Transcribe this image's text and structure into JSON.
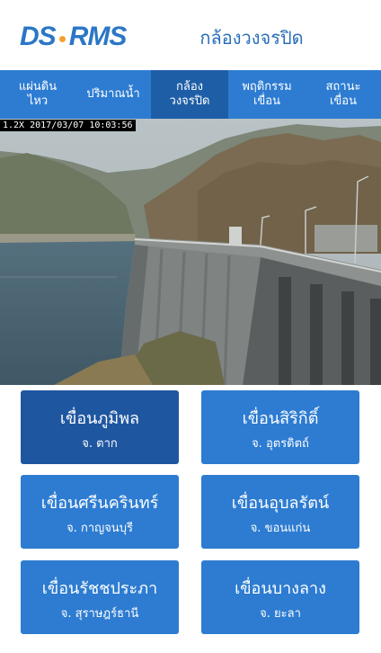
{
  "header": {
    "logo_left": "DS",
    "logo_right": "RMS",
    "title": "กล้องวงจรปิด"
  },
  "tabs": [
    {
      "label": "แผ่นดิน\nไหว"
    },
    {
      "label": "ปริมาณน้ำ"
    },
    {
      "label": "กล้อง\nวงจรปิด"
    },
    {
      "label": "พฤติกรรม\nเขื่อน"
    },
    {
      "label": "สถานะ\nเขื่อน"
    }
  ],
  "camera": {
    "timestamp": "1.2X 2017/03/07 10:03:56"
  },
  "dams": [
    {
      "name": "เขื่อนภูมิพล",
      "province": "จ. ตาก"
    },
    {
      "name": "เขื่อนสิริกิติ์",
      "province": "จ. อุตรดิตถ์"
    },
    {
      "name": "เขื่อนศรีนครินทร์",
      "province": "จ. กาญจนบุรี"
    },
    {
      "name": "เขื่อนอุบลรัตน์",
      "province": "จ. ขอนแก่น"
    },
    {
      "name": "เขื่อนรัชชประภา",
      "province": "จ. สุราษฎร์ธานี"
    },
    {
      "name": "เขื่อนบางลาง",
      "province": "จ. ยะลา"
    }
  ],
  "colors": {
    "accent": "#2d7cd1",
    "active": "#1e5ea6",
    "title": "#2a6fb8"
  }
}
